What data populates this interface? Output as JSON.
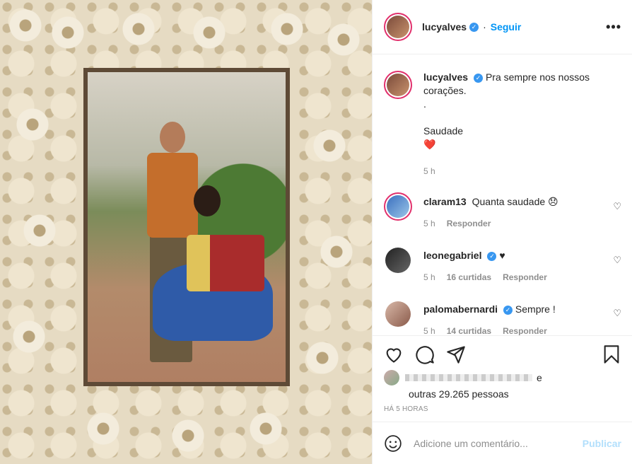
{
  "post": {
    "username": "lucyalves",
    "follow_label": "Seguir",
    "more_label": "•••",
    "caption_line1": "Pra sempre nos nossos",
    "caption_line2": "corações.",
    "caption_dot": ".",
    "caption_line3": "Saudade",
    "caption_emoji": "❤️",
    "caption_time": "5 h"
  },
  "comments": [
    {
      "username": "claram13",
      "text": "Quanta saudade 😞",
      "time": "5 h",
      "reply_label": "Responder"
    },
    {
      "username": "leonegabriel",
      "text": "♥",
      "time": "5 h",
      "likes_label": "16 curtidas",
      "reply_label": "Responder"
    },
    {
      "username": "palomabernardi",
      "text": "Sempre !",
      "time": "5 h",
      "likes_label": "14 curtidas",
      "reply_label": "Responder"
    }
  ],
  "likes": {
    "suffix": "e",
    "others_text": "outras 29.265 pessoas"
  },
  "time_ago": "HÁ 5 HORAS",
  "add_comment": {
    "placeholder": "Adicione um comentário...",
    "publish_label": "Publicar"
  },
  "icons": [
    "heart-icon",
    "comment-icon",
    "share-icon",
    "bookmark-icon",
    "emoji-icon",
    "verified-icon"
  ],
  "colors": {
    "link": "#0095f6",
    "verified": "#3897f0",
    "publish_disabled": "#b2dffc",
    "muted": "#8e8e8e"
  }
}
